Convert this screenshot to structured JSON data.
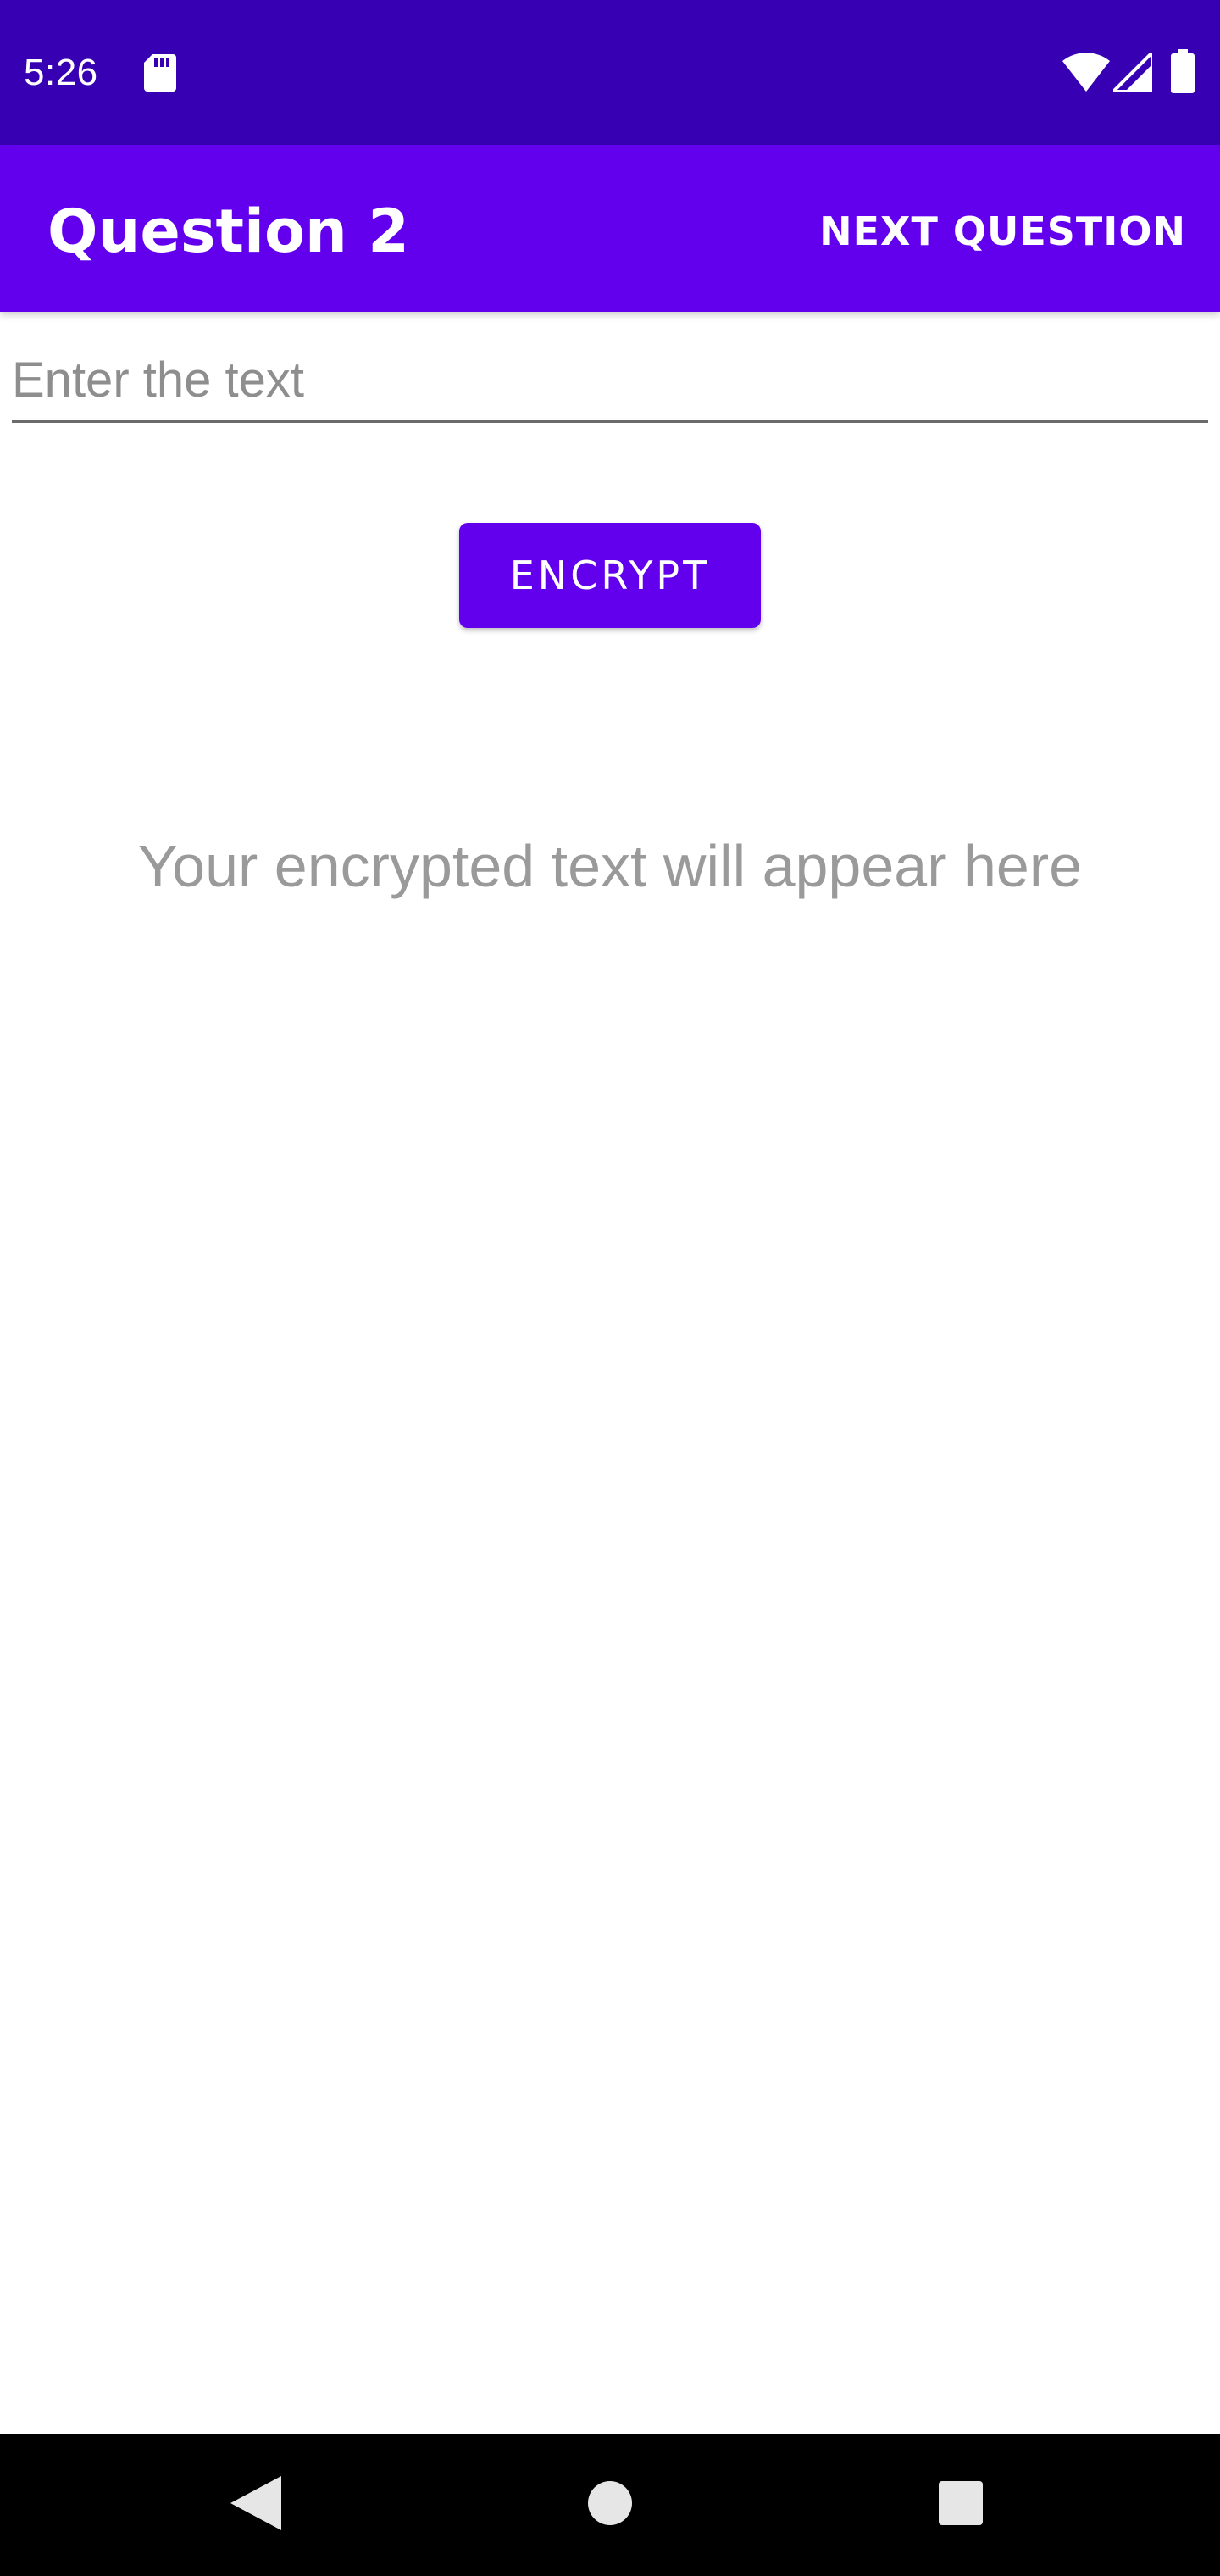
{
  "status_bar": {
    "time": "5:26",
    "icons": [
      "sd-card-icon",
      "wifi-icon",
      "signal-icon",
      "battery-icon"
    ]
  },
  "app_bar": {
    "title": "Question 2",
    "action_label": "NEXT QUESTION"
  },
  "input": {
    "value": "",
    "placeholder": "Enter the text"
  },
  "encrypt_button": {
    "label": "ENCRYPT"
  },
  "output": {
    "text": "Your encrypted text will appear here"
  },
  "nav_bar": {
    "icons": [
      "back-icon",
      "home-icon",
      "recents-icon"
    ]
  },
  "colors": {
    "status_bar": "#3700B3",
    "primary": "#6200EE",
    "output_text": "#9a9a9a",
    "nav_bar": "#000000"
  }
}
